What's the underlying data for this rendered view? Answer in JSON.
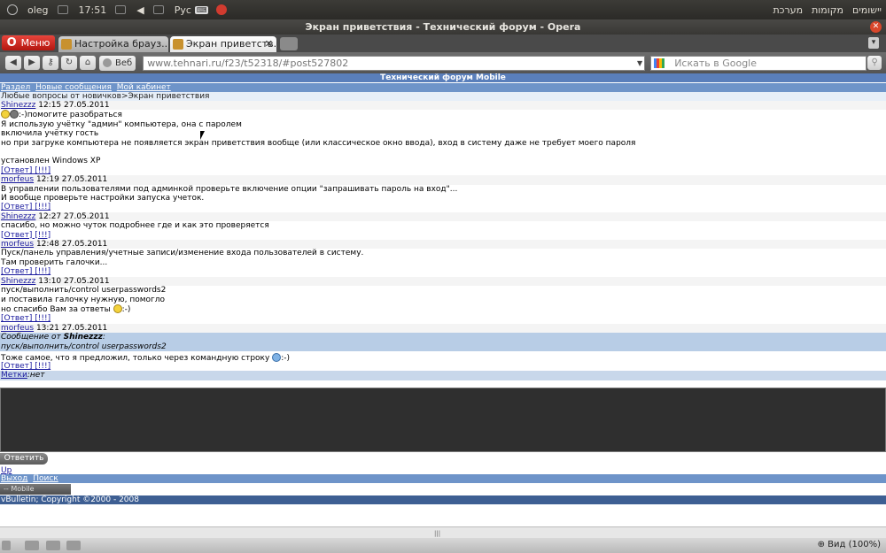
{
  "system": {
    "user": "oleg",
    "time": "17:51",
    "layout": "Рус",
    "menus": [
      "מערכת",
      "מקומות",
      "יישומים"
    ]
  },
  "window": {
    "title": "Экран приветствия - Технический форум - Opera"
  },
  "tabs": {
    "menu_label": "Меню",
    "items": [
      {
        "label": "Настройка брауз..."
      },
      {
        "label": "Экран приветств..."
      }
    ]
  },
  "toolbar": {
    "veb_label": "Веб",
    "address": "www.tehnari.ru/f23/t52318/#post527802",
    "search_placeholder": "Искать в Google"
  },
  "page": {
    "forum_title": "Технический форум Mobile",
    "nav": [
      "Раздел",
      "Новые сообщения",
      "Мой кабинет"
    ],
    "breadcrumb": "Любые вопросы от новичков>Экран приветствия",
    "posts": [
      {
        "author": "Shinezzz",
        "date": "12:15 27.05.2011",
        "lines": [
          ":-)помогите разобраться",
          "Я использую учётку \"админ\" компьютера, она с паролем",
          "включила учётку гость",
          "но при загруке компьютера не появляется экран приветствия вообще (или классическое окно ввода), вход в систему даже не требует моего пароля",
          "",
          "установлен Windows XP"
        ],
        "actions": "[Ответ] [!!!]"
      },
      {
        "author": "morfeus",
        "date": "12:19 27.05.2011",
        "lines": [
          "В управлении пользователями под админкой проверьте включение опции \"запрашивать пароль на вход\"...",
          "И вообще проверьте настройки запуска учеток."
        ],
        "actions": "[Ответ] [!!!]"
      },
      {
        "author": "Shinezzz",
        "date": "12:27 27.05.2011",
        "lines": [
          "спасибо, но можно чуток подробнее где и как это проверяется"
        ],
        "actions": "[Ответ] [!!!]"
      },
      {
        "author": "morfeus",
        "date": "12:48 27.05.2011",
        "lines": [
          "Пуск/панель управления/учетные записи/изменение входа пользователей в систему.",
          "Там проверить галочки..."
        ],
        "actions": "[Ответ] [!!!]"
      },
      {
        "author": "Shinezzz",
        "date": "13:10 27.05.2011",
        "lines": [
          "пуск/выполнить/control userpasswords2",
          "и поставила галочку нужную, помогло",
          "но спасибо Вам за ответы"
        ],
        "last_suffix": ":-)",
        "actions": "[Ответ] [!!!]"
      }
    ],
    "last_post": {
      "author": "morfeus",
      "date": "13:21 27.05.2011",
      "quote_label": "Сообщение от",
      "quote_author": "Shinezzz",
      "quote_text": "пуск/выполнить/control userpasswords2",
      "text": "Тоже самое, что я предложил, только через командную строку",
      "suffix": ":-)",
      "actions": "[Ответ] [!!!]"
    },
    "tags_label": "Метки",
    "tags_value": ":нет",
    "reply_button": "Ответить",
    "up_link": "Up",
    "bottom_nav": [
      "Выход",
      "Поиск"
    ],
    "mobile_select": "-- Mobile",
    "copyright": "vBulletin; Copyright ©2000 - 2008"
  },
  "status": {
    "zoom": "Вид (100%)"
  }
}
